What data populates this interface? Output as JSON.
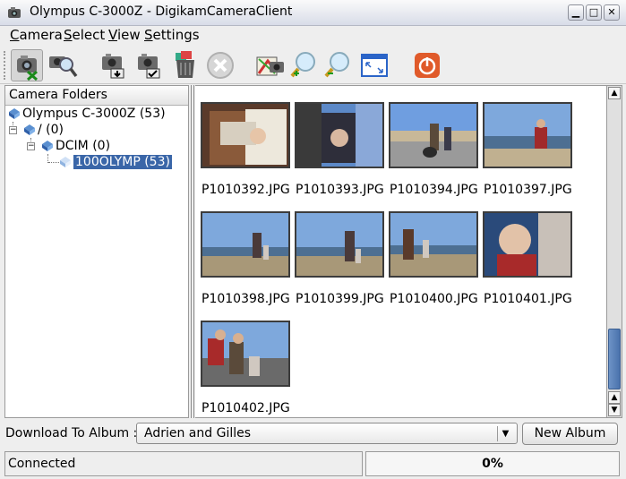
{
  "window": {
    "title": "Olympus C-3000Z - DigikamCameraClient"
  },
  "menubar": {
    "items": [
      {
        "mnemonic": "C",
        "rest": "amera"
      },
      {
        "mnemonic": "S",
        "rest": "elect"
      },
      {
        "mnemonic": "V",
        "rest": "iew"
      },
      {
        "mnemonic": "S",
        "rest": "ettings"
      }
    ]
  },
  "toolbar": {
    "icons": [
      "camera-disconnect-icon",
      "camera-info-icon",
      "download-icon",
      "download-selected-icon",
      "delete-icon",
      "cancel-icon",
      "camera-photo-icon",
      "zoom-in-icon",
      "zoom-out-icon",
      "fullscreen-icon",
      "quit-icon"
    ]
  },
  "folders": {
    "header": "Camera Folders",
    "tree": [
      {
        "label": "Olympus C-3000Z (53)"
      },
      {
        "label": "/ (0)"
      },
      {
        "label": "DCIM (0)"
      },
      {
        "label": "100OLYMP (53)",
        "selected": true
      }
    ]
  },
  "thumbnails": [
    {
      "name": "P1010392.JPG"
    },
    {
      "name": "P1010393.JPG"
    },
    {
      "name": "P1010394.JPG"
    },
    {
      "name": "P1010397.JPG"
    },
    {
      "name": "P1010398.JPG"
    },
    {
      "name": "P1010399.JPG"
    },
    {
      "name": "P1010400.JPG"
    },
    {
      "name": "P1010401.JPG"
    },
    {
      "name": "P1010402.JPG"
    }
  ],
  "download": {
    "label": "Download To Album :",
    "album": "Adrien and Gilles",
    "new_album_label": "New Album"
  },
  "status": {
    "text": "Connected",
    "progress_label": "0%",
    "progress_value": 0
  },
  "colors": {
    "selection": "#3a66a8",
    "scrollbar_thumb": "#4a72ad",
    "quit_button": "#e05a2a"
  }
}
